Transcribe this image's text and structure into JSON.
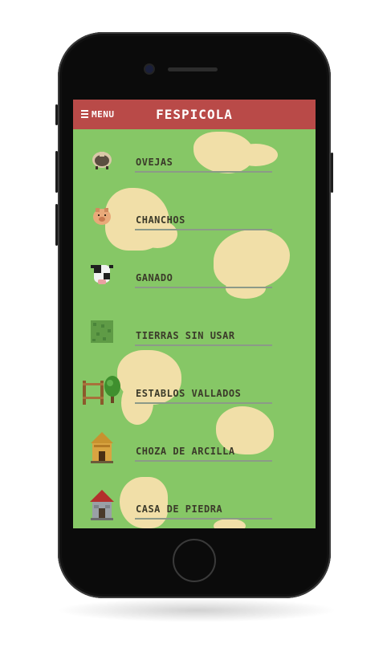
{
  "app": {
    "title": "FESPICOLA",
    "menu_label": "MENU"
  },
  "items": [
    {
      "label": "OVEJAS",
      "icon": "sheep-icon"
    },
    {
      "label": "CHANCHOS",
      "icon": "pig-icon"
    },
    {
      "label": "GANADO",
      "icon": "cow-icon"
    },
    {
      "label": "TIERRAS SIN USAR",
      "icon": "grass-tile-icon"
    },
    {
      "label": "ESTABLOS VALLADOS",
      "icon": "fence-tree-icon"
    },
    {
      "label": "CHOZA DE ARCILLA",
      "icon": "clay-hut-icon"
    },
    {
      "label": "CASA DE PIEDRA",
      "icon": "stone-house-icon"
    }
  ],
  "colors": {
    "header": "#b94a48",
    "grass": "#86c766",
    "sand": "#f1dfa8"
  }
}
